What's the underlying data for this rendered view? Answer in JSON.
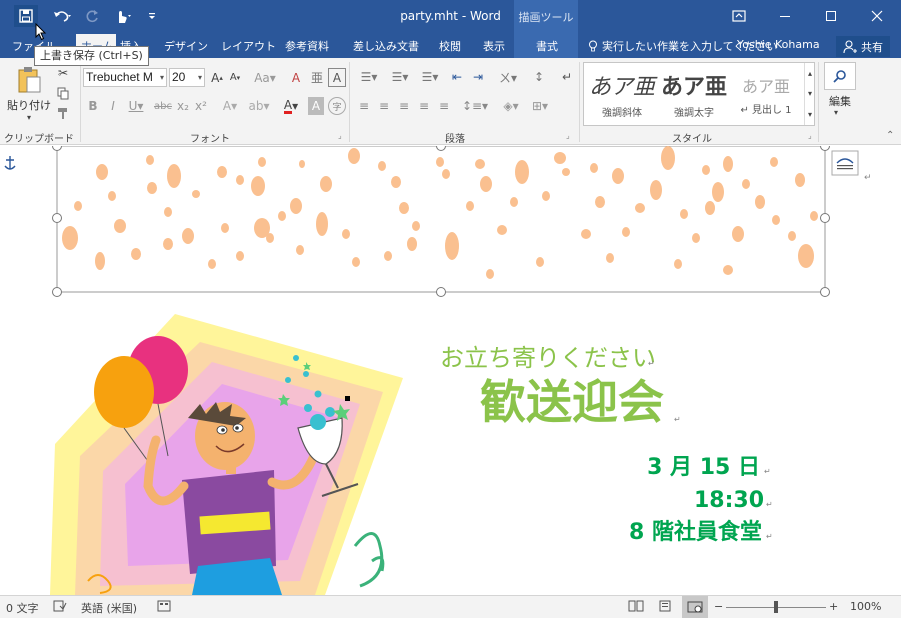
{
  "titlebar": {
    "document_title": "party.mht - Word",
    "contextual_group": "描画ツール"
  },
  "tabs": {
    "file": "ファイル",
    "home": "ホーム",
    "insert": "挿入",
    "design": "デザイン",
    "layout": "レイアウト",
    "references": "参考資料",
    "mailings": "差し込み文書",
    "review": "校閲",
    "view": "表示",
    "format": "書式",
    "tell_me": "実行したい作業を入力してください",
    "user_name": "Yoshie Kohama",
    "share": "共有"
  },
  "tooltip": {
    "text": "上書き保存 (Ctrl+S)"
  },
  "ribbon": {
    "paste_label": "貼り付け",
    "clipboard_group": "クリップボード",
    "font_name": "Trebuchet M",
    "font_size": "20",
    "font_group": "フォント",
    "paragraph_group": "段落",
    "styles_group": "スタイル",
    "editing_label": "編集",
    "styles": [
      {
        "preview": "あア亜",
        "name": "強調斜体"
      },
      {
        "preview": "あア亜",
        "name": "強調太字"
      },
      {
        "preview": "あア亜",
        "name": "↵ 見出し 1"
      }
    ]
  },
  "document": {
    "line1": "お立ち寄りください",
    "line2": "歓送迎会",
    "date": "3 月 15 日",
    "time": "18:30",
    "place": "8 階社員食堂",
    "paragraph_mark": "↵"
  },
  "statusbar": {
    "word_count": "0 文字",
    "language": "英語 (米国)",
    "zoom": "100%"
  },
  "colors": {
    "word_blue": "#2b579a",
    "heading_green": "#8bc34a",
    "detail_green": "#00a550",
    "dot_color": "#fac090"
  }
}
